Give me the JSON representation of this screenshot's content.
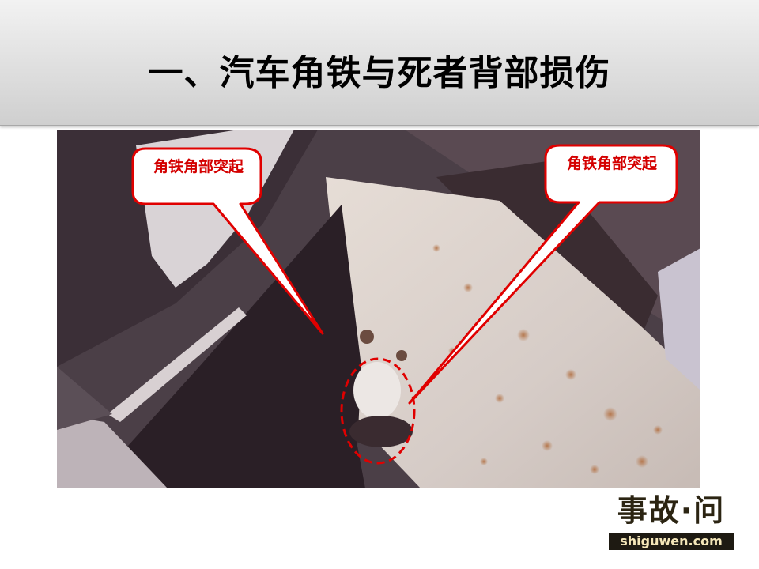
{
  "slide": {
    "title": "一、汽车角铁与死者背部损伤"
  },
  "annotations": {
    "left_label": "角铁角部突起",
    "right_label": "角铁角部突起",
    "accent_color": "#e00000"
  },
  "watermark": {
    "logo_text": "事故·问",
    "url": "shiguwen.com"
  }
}
